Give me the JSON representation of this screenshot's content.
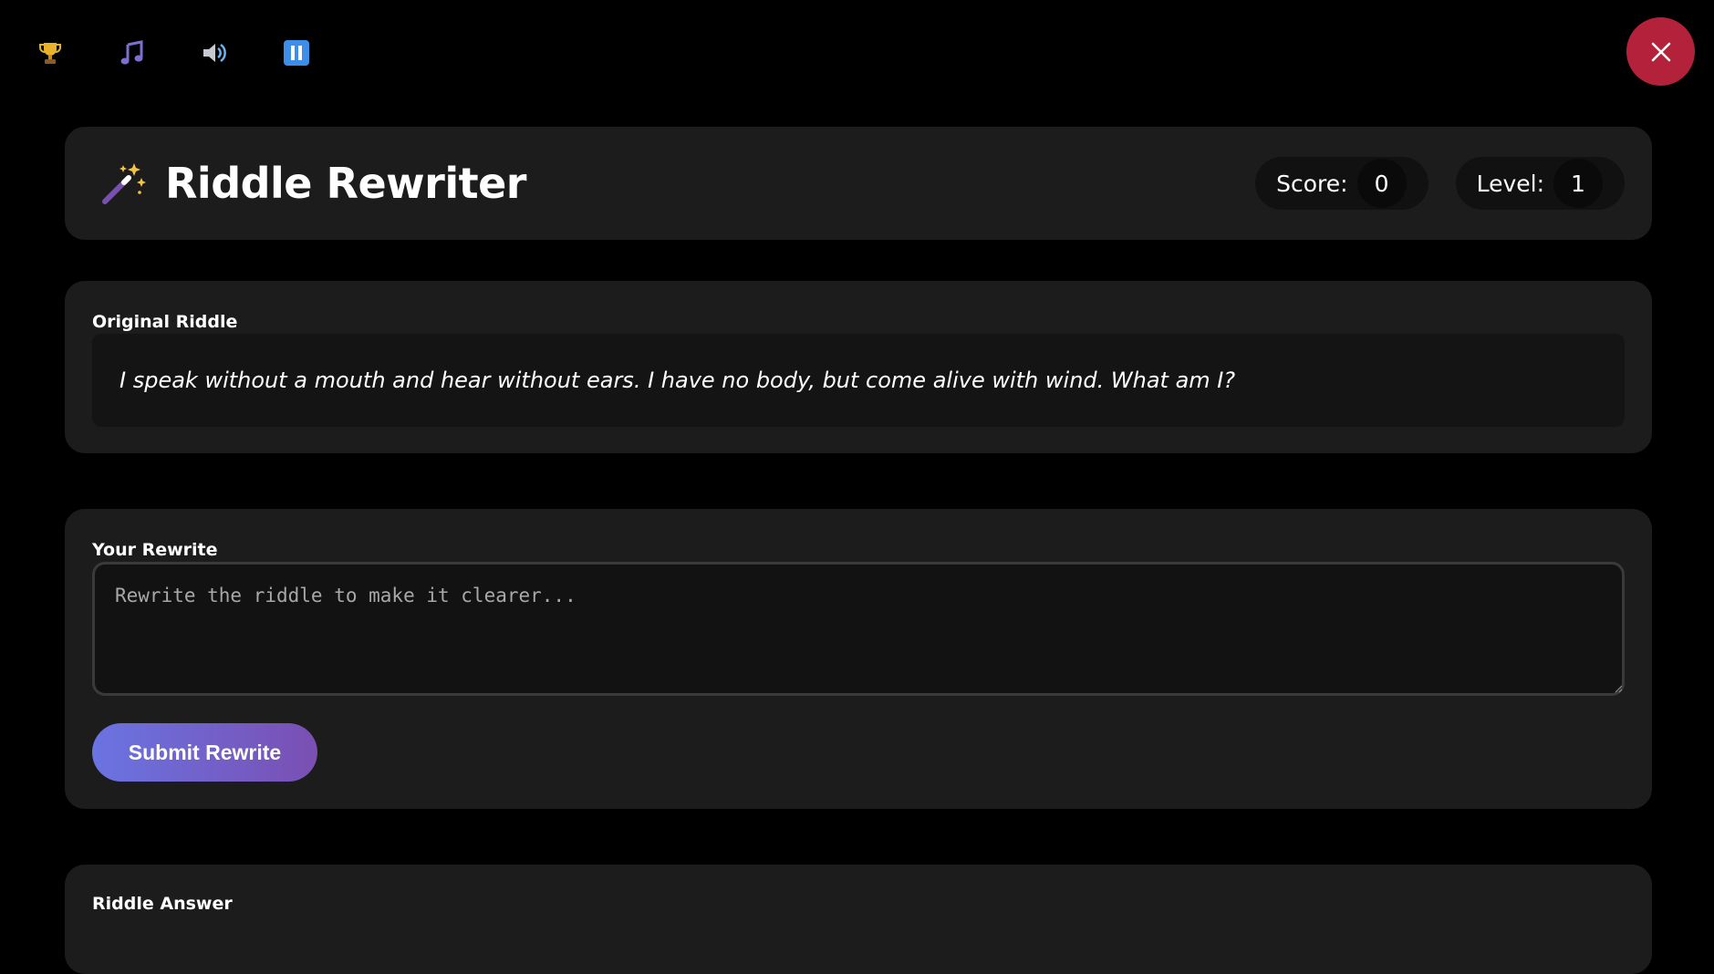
{
  "toolbar": {
    "icons": [
      {
        "name": "trophy-icon",
        "glyph": "🏆"
      },
      {
        "name": "music-icon",
        "glyph": "🎵"
      },
      {
        "name": "speaker-icon",
        "glyph": "🔊"
      },
      {
        "name": "pause-icon",
        "glyph": "⏸"
      }
    ]
  },
  "close_button": {
    "icon": "close-icon",
    "color": "#b3223a"
  },
  "header": {
    "title": "Riddle Rewriter",
    "title_icon": "magic-wand-icon",
    "score_label": "Score:",
    "score_value": "0",
    "level_label": "Level:",
    "level_value": "1"
  },
  "original_riddle": {
    "label": "Original Riddle",
    "text": "I speak without a mouth and hear without ears. I have no body, but come alive with wind. What am I?"
  },
  "rewrite": {
    "label": "Your Rewrite",
    "value": "",
    "placeholder": "Rewrite the riddle to make it clearer...",
    "submit_label": "Submit Rewrite"
  },
  "answer": {
    "label": "Riddle Answer"
  },
  "colors": {
    "background": "#000000",
    "panel": "#1c1c1c",
    "close_button": "#b3223a",
    "submit_gradient_start": "#6a74e2",
    "submit_gradient_end": "#7a4fb2"
  }
}
